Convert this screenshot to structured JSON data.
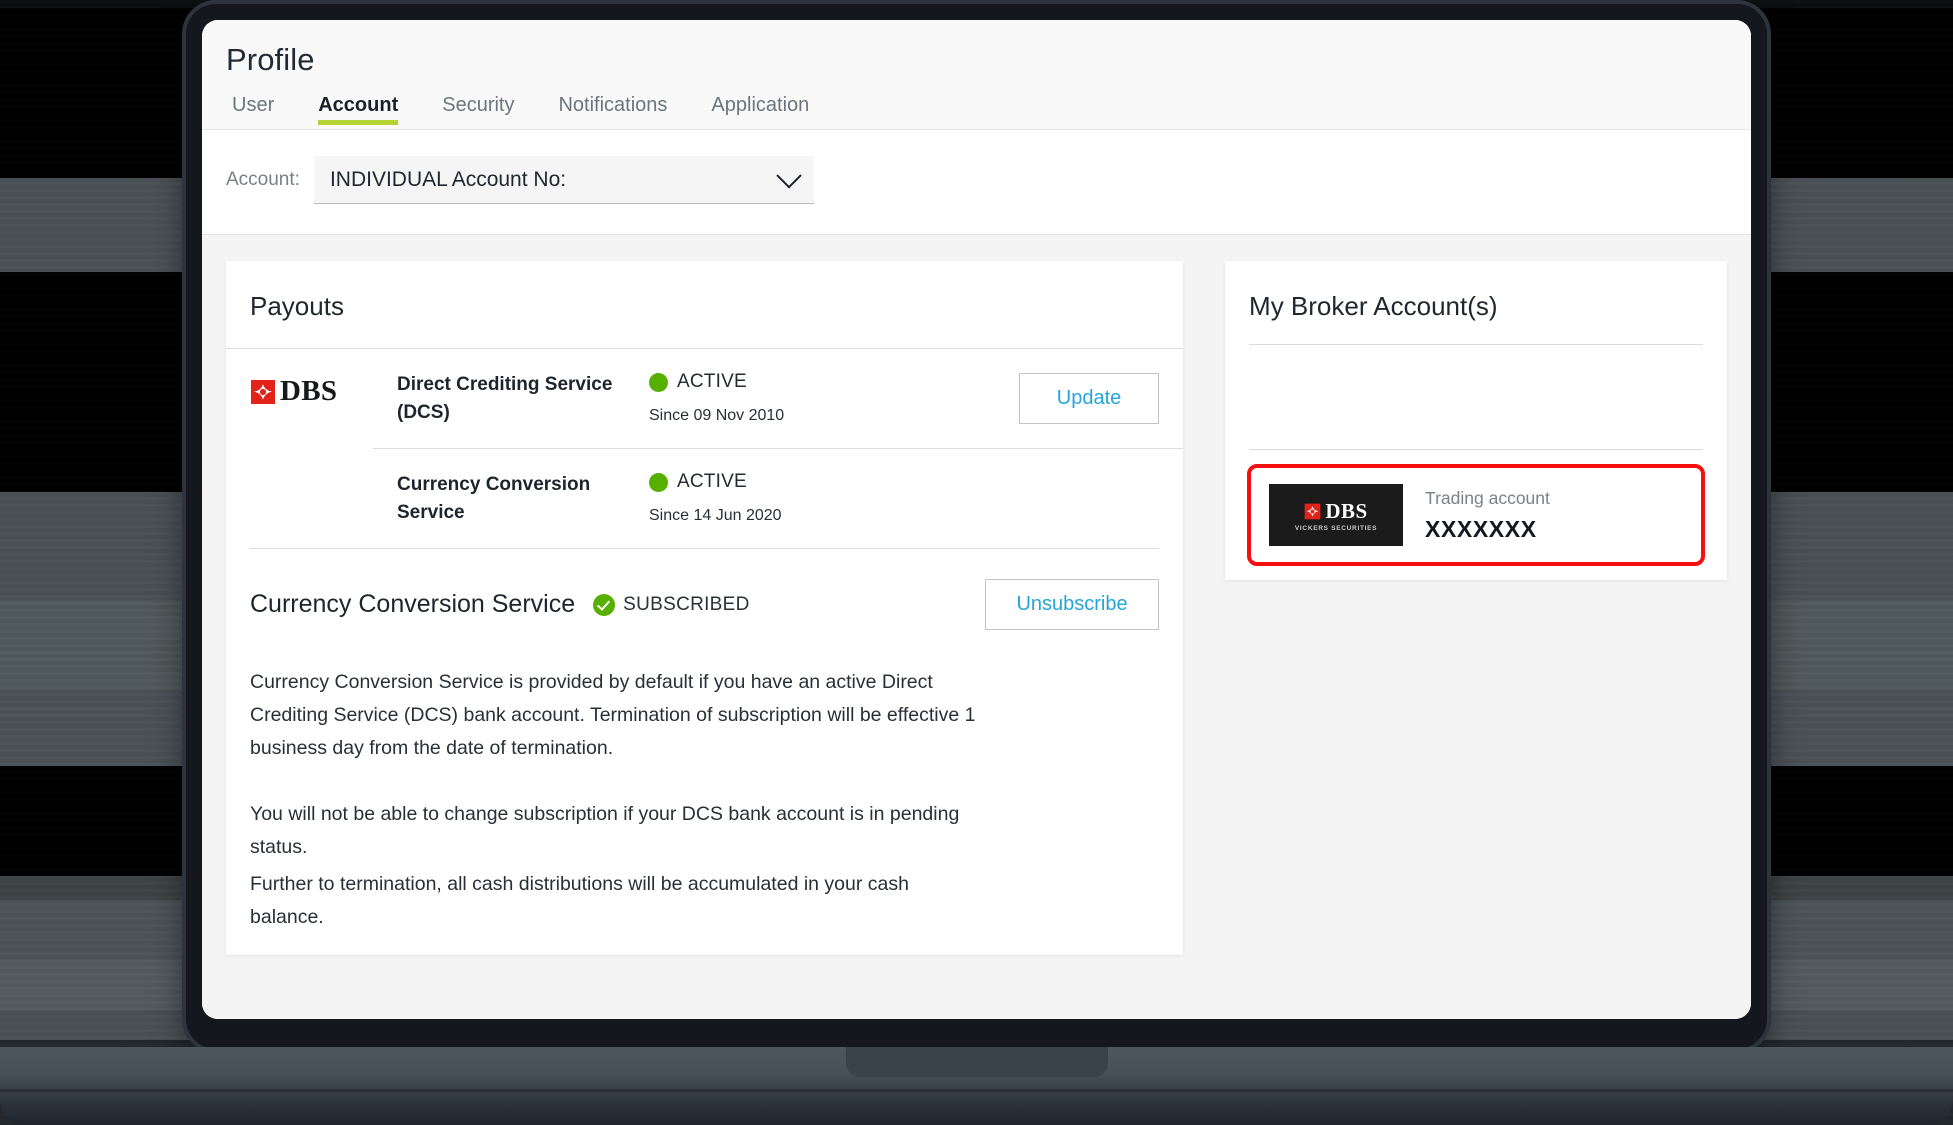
{
  "app": {
    "page_title": "Profile",
    "tabs": [
      {
        "label": "User",
        "active": false
      },
      {
        "label": "Account",
        "active": true
      },
      {
        "label": "Security",
        "active": false
      },
      {
        "label": "Notifications",
        "active": false
      },
      {
        "label": "Application",
        "active": false
      }
    ],
    "accent_color": "#b6d334",
    "link_color": "#25a5d8",
    "status_green": "#56b000",
    "highlight_red": "#f50f0f"
  },
  "account_selector": {
    "label": "Account:",
    "value": "INDIVIDUAL Account No:",
    "chevron_icon": "chevron-down-icon"
  },
  "payouts": {
    "title": "Payouts",
    "bank_logo_text": "DBS",
    "rows": [
      {
        "name": "Direct Crediting Service (DCS)",
        "status": "ACTIVE",
        "since": "Since 09 Nov 2010",
        "action_label": "Update",
        "has_logo": true
      },
      {
        "name": "Currency Conversion Service",
        "status": "ACTIVE",
        "since": "Since 14 Jun 2020",
        "action_label": "",
        "has_logo": false
      }
    ]
  },
  "ccs": {
    "title": "Currency Conversion Service",
    "badge_text": "SUBSCRIBED",
    "badge_icon": "check-circle-icon",
    "action_label": "Unsubscribe",
    "paragraph_1": "Currency Conversion Service is provided by default if you have an active Direct Crediting Service (DCS) bank account. Termination of subscription will be effective 1 business day from the date of termination.",
    "paragraph_2": "You will not be able to change subscription if your DCS bank account is in pending status.",
    "paragraph_3": "Further to termination, all cash distributions will be accumulated in your cash balance."
  },
  "broker": {
    "title": "My Broker Account(s)",
    "highlighted_account": {
      "logo_name": "DBS",
      "logo_sub": "VICKERS SECURITIES",
      "label": "Trading account",
      "value": "XXXXXXX"
    }
  }
}
